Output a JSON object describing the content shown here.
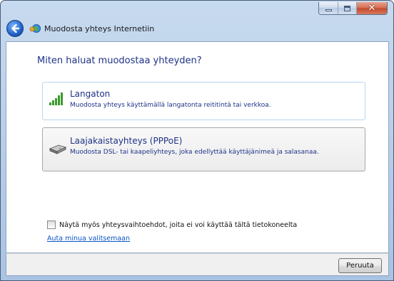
{
  "window": {
    "title": "Muodosta yhteys Internetiin",
    "close_glyph": "✕"
  },
  "heading": "Miten haluat muodostaa yhteyden?",
  "options": [
    {
      "title": "Langaton",
      "description": "Muodosta yhteys käyttämällä langatonta reititintä tai verkkoa.",
      "icon": "wireless-signal-icon"
    },
    {
      "title": "Laajakaistayhteys (PPPoE)",
      "description": "Muodosta DSL- tai kaapeliyhteys, joka edellyttää käyttäjänimeä ja salasanaa.",
      "icon": "broadband-modem-icon"
    }
  ],
  "show_unavailable": {
    "label": "Näytä myös yhteysvaihtoehdot, joita ei voi käyttää tältä tietokoneelta",
    "checked": false
  },
  "help_link": "Auta minua valitsemaan",
  "cancel_button": "Peruuta",
  "colors": {
    "link_blue": "#1e3287",
    "hyperlink": "#0b55c4",
    "close_red": "#c44a2a"
  }
}
